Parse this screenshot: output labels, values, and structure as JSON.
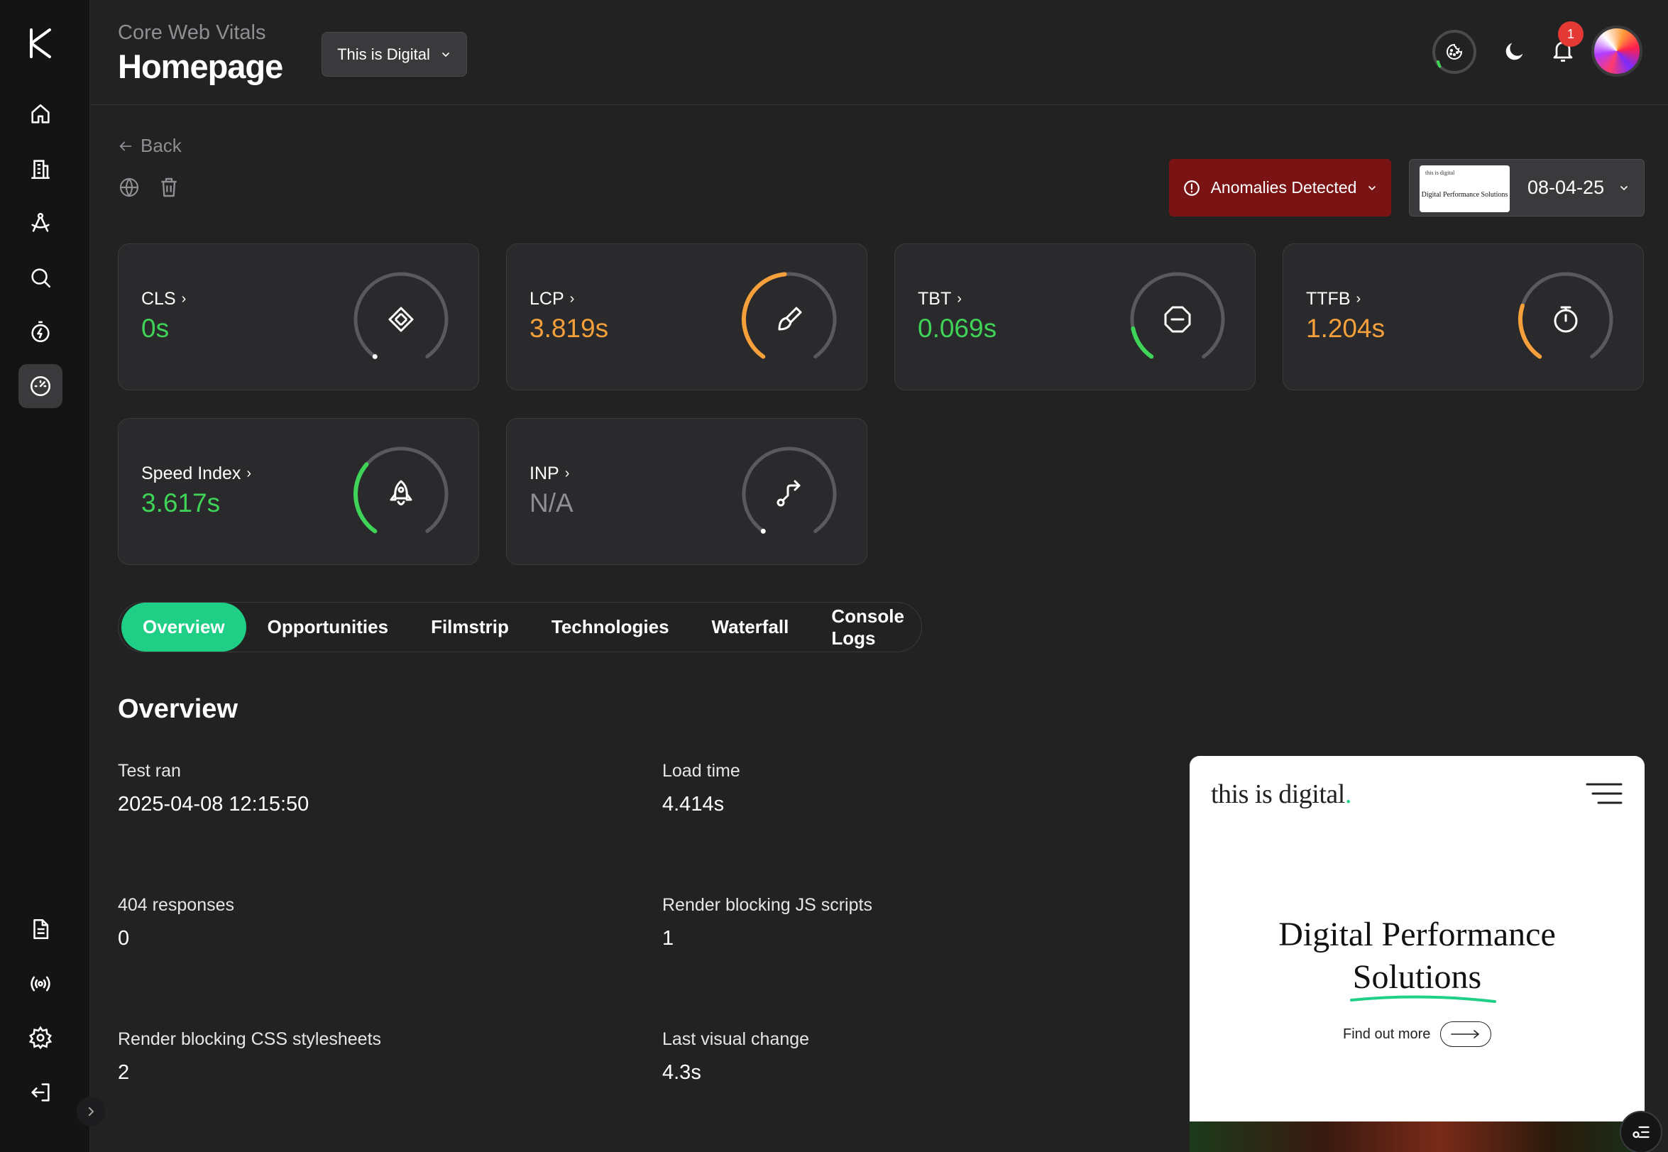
{
  "header": {
    "subtitle": "Core Web Vitals",
    "title": "Homepage",
    "site_select": "This is Digital",
    "notifications_count": "1"
  },
  "actions": {
    "back_label": "Back",
    "anomalies_label": "Anomalies Detected",
    "date_label": "08-04-25",
    "thumb_brand": "this is digital",
    "thumb_heading": "Digital Performance Solutions"
  },
  "metrics": [
    {
      "label": "CLS",
      "value": "0s",
      "status_color": "#3fd457",
      "progress": 0.0
    },
    {
      "label": "LCP",
      "value": "3.819s",
      "status_color": "#f5a03b",
      "progress": 0.48
    },
    {
      "label": "TBT",
      "value": "0.069s",
      "status_color": "#3fd457",
      "progress": 0.15
    },
    {
      "label": "TTFB",
      "value": "1.204s",
      "status_color": "#f5a03b",
      "progress": 0.25
    },
    {
      "label": "Speed Index",
      "value": "3.617s",
      "status_color": "#3fd457",
      "progress": 0.33
    },
    {
      "label": "INP",
      "value": "N/A",
      "status_color": "#8e8e93",
      "progress": 0.0
    }
  ],
  "tabs": [
    "Overview",
    "Opportunities",
    "Filmstrip",
    "Technologies",
    "Waterfall",
    "Console Logs"
  ],
  "overview": {
    "title": "Overview",
    "stats": [
      {
        "label": "Test ran",
        "value": "2025-04-08 12:15:50"
      },
      {
        "label": "Load time",
        "value": "4.414s"
      },
      {
        "label": "404 responses",
        "value": "0"
      },
      {
        "label": "Render blocking JS scripts",
        "value": "1"
      },
      {
        "label": "Render blocking CSS stylesheets",
        "value": "2"
      },
      {
        "label": "Last visual change",
        "value": "4.3s"
      }
    ]
  },
  "preview": {
    "brand": "this is digital",
    "brand_dot": ".",
    "heading_line1": "Digital Performance",
    "heading_line2": "Solutions",
    "cta": "Find out more"
  },
  "colors": {
    "accent": "#1fcf86",
    "good": "#3fd457",
    "warn": "#f5a03b",
    "danger": "#7a1414"
  }
}
